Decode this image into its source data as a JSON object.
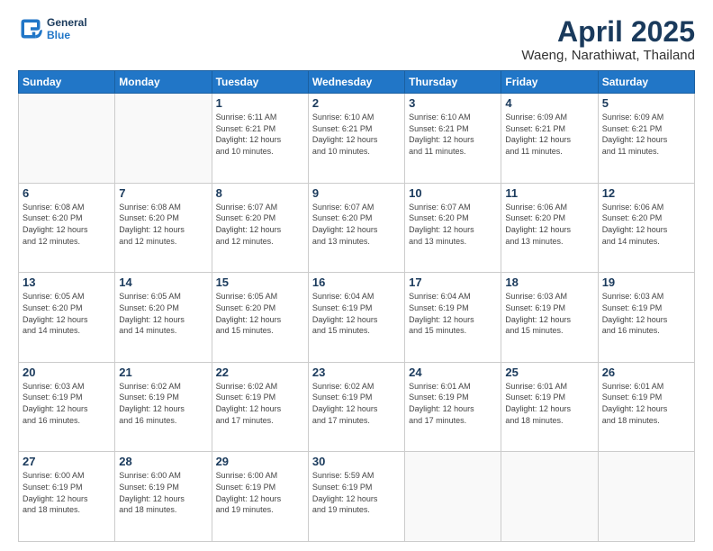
{
  "header": {
    "logo_line1": "General",
    "logo_line2": "Blue",
    "title": "April 2025",
    "subtitle": "Waeng, Narathiwat, Thailand"
  },
  "weekdays": [
    "Sunday",
    "Monday",
    "Tuesday",
    "Wednesday",
    "Thursday",
    "Friday",
    "Saturday"
  ],
  "weeks": [
    [
      {
        "day": "",
        "info": ""
      },
      {
        "day": "",
        "info": ""
      },
      {
        "day": "1",
        "info": "Sunrise: 6:11 AM\nSunset: 6:21 PM\nDaylight: 12 hours\nand 10 minutes."
      },
      {
        "day": "2",
        "info": "Sunrise: 6:10 AM\nSunset: 6:21 PM\nDaylight: 12 hours\nand 10 minutes."
      },
      {
        "day": "3",
        "info": "Sunrise: 6:10 AM\nSunset: 6:21 PM\nDaylight: 12 hours\nand 11 minutes."
      },
      {
        "day": "4",
        "info": "Sunrise: 6:09 AM\nSunset: 6:21 PM\nDaylight: 12 hours\nand 11 minutes."
      },
      {
        "day": "5",
        "info": "Sunrise: 6:09 AM\nSunset: 6:21 PM\nDaylight: 12 hours\nand 11 minutes."
      }
    ],
    [
      {
        "day": "6",
        "info": "Sunrise: 6:08 AM\nSunset: 6:20 PM\nDaylight: 12 hours\nand 12 minutes."
      },
      {
        "day": "7",
        "info": "Sunrise: 6:08 AM\nSunset: 6:20 PM\nDaylight: 12 hours\nand 12 minutes."
      },
      {
        "day": "8",
        "info": "Sunrise: 6:07 AM\nSunset: 6:20 PM\nDaylight: 12 hours\nand 12 minutes."
      },
      {
        "day": "9",
        "info": "Sunrise: 6:07 AM\nSunset: 6:20 PM\nDaylight: 12 hours\nand 13 minutes."
      },
      {
        "day": "10",
        "info": "Sunrise: 6:07 AM\nSunset: 6:20 PM\nDaylight: 12 hours\nand 13 minutes."
      },
      {
        "day": "11",
        "info": "Sunrise: 6:06 AM\nSunset: 6:20 PM\nDaylight: 12 hours\nand 13 minutes."
      },
      {
        "day": "12",
        "info": "Sunrise: 6:06 AM\nSunset: 6:20 PM\nDaylight: 12 hours\nand 14 minutes."
      }
    ],
    [
      {
        "day": "13",
        "info": "Sunrise: 6:05 AM\nSunset: 6:20 PM\nDaylight: 12 hours\nand 14 minutes."
      },
      {
        "day": "14",
        "info": "Sunrise: 6:05 AM\nSunset: 6:20 PM\nDaylight: 12 hours\nand 14 minutes."
      },
      {
        "day": "15",
        "info": "Sunrise: 6:05 AM\nSunset: 6:20 PM\nDaylight: 12 hours\nand 15 minutes."
      },
      {
        "day": "16",
        "info": "Sunrise: 6:04 AM\nSunset: 6:19 PM\nDaylight: 12 hours\nand 15 minutes."
      },
      {
        "day": "17",
        "info": "Sunrise: 6:04 AM\nSunset: 6:19 PM\nDaylight: 12 hours\nand 15 minutes."
      },
      {
        "day": "18",
        "info": "Sunrise: 6:03 AM\nSunset: 6:19 PM\nDaylight: 12 hours\nand 15 minutes."
      },
      {
        "day": "19",
        "info": "Sunrise: 6:03 AM\nSunset: 6:19 PM\nDaylight: 12 hours\nand 16 minutes."
      }
    ],
    [
      {
        "day": "20",
        "info": "Sunrise: 6:03 AM\nSunset: 6:19 PM\nDaylight: 12 hours\nand 16 minutes."
      },
      {
        "day": "21",
        "info": "Sunrise: 6:02 AM\nSunset: 6:19 PM\nDaylight: 12 hours\nand 16 minutes."
      },
      {
        "day": "22",
        "info": "Sunrise: 6:02 AM\nSunset: 6:19 PM\nDaylight: 12 hours\nand 17 minutes."
      },
      {
        "day": "23",
        "info": "Sunrise: 6:02 AM\nSunset: 6:19 PM\nDaylight: 12 hours\nand 17 minutes."
      },
      {
        "day": "24",
        "info": "Sunrise: 6:01 AM\nSunset: 6:19 PM\nDaylight: 12 hours\nand 17 minutes."
      },
      {
        "day": "25",
        "info": "Sunrise: 6:01 AM\nSunset: 6:19 PM\nDaylight: 12 hours\nand 18 minutes."
      },
      {
        "day": "26",
        "info": "Sunrise: 6:01 AM\nSunset: 6:19 PM\nDaylight: 12 hours\nand 18 minutes."
      }
    ],
    [
      {
        "day": "27",
        "info": "Sunrise: 6:00 AM\nSunset: 6:19 PM\nDaylight: 12 hours\nand 18 minutes."
      },
      {
        "day": "28",
        "info": "Sunrise: 6:00 AM\nSunset: 6:19 PM\nDaylight: 12 hours\nand 18 minutes."
      },
      {
        "day": "29",
        "info": "Sunrise: 6:00 AM\nSunset: 6:19 PM\nDaylight: 12 hours\nand 19 minutes."
      },
      {
        "day": "30",
        "info": "Sunrise: 5:59 AM\nSunset: 6:19 PM\nDaylight: 12 hours\nand 19 minutes."
      },
      {
        "day": "",
        "info": ""
      },
      {
        "day": "",
        "info": ""
      },
      {
        "day": "",
        "info": ""
      }
    ]
  ]
}
